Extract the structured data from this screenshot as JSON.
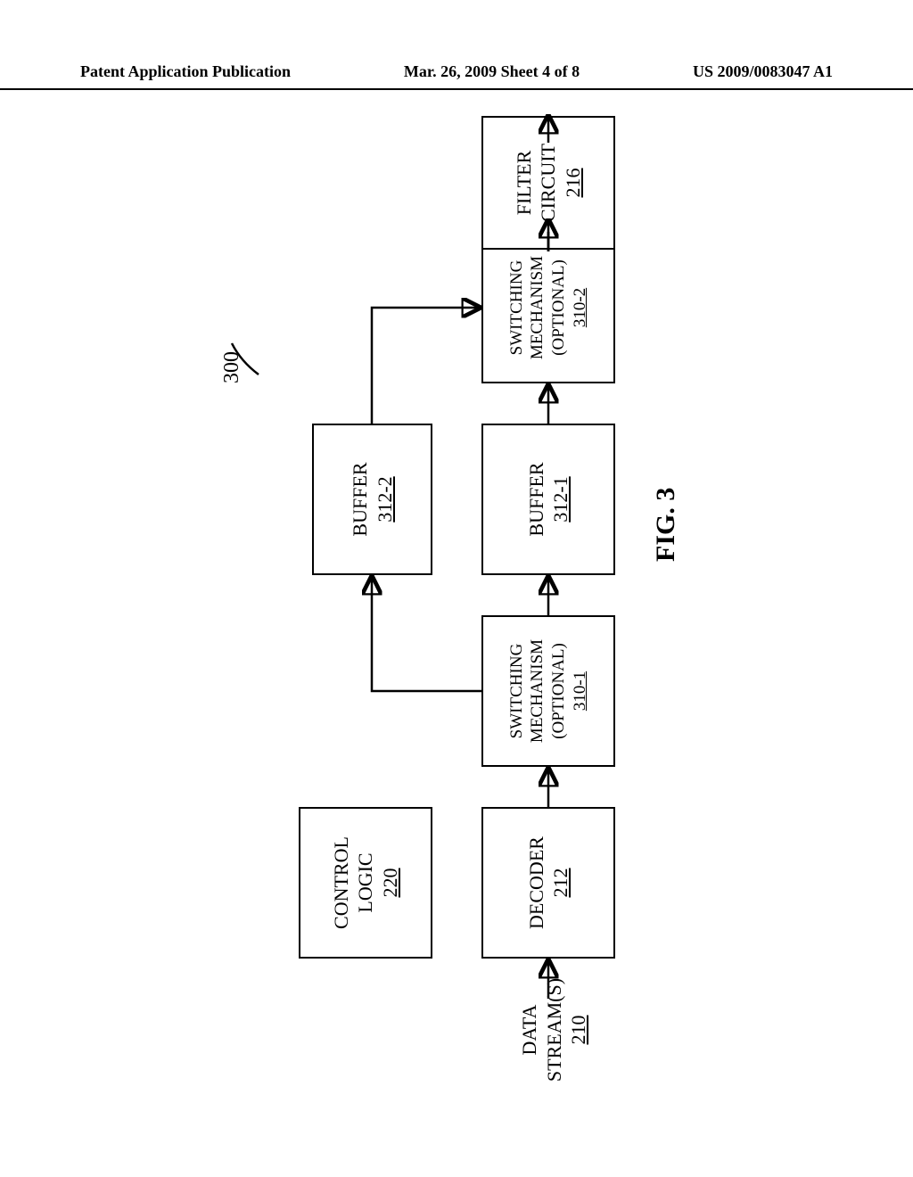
{
  "header": {
    "left": "Patent Application Publication",
    "center": "Mar. 26, 2009  Sheet 4 of 8",
    "right": "US 2009/0083047 A1"
  },
  "figure": {
    "ref_label": "300",
    "caption": "FIG. 3",
    "input": {
      "l1": "DATA",
      "l2": "STREAM(S)",
      "ref": "210"
    },
    "decoder": {
      "l1": "DECODER",
      "ref": "212"
    },
    "control": {
      "l1": "CONTROL",
      "l2": "LOGIC",
      "ref": "220"
    },
    "switch1": {
      "l1": "SWITCHING",
      "l2": "MECHANISM",
      "l3": "(OPTIONAL)",
      "ref": "310-1"
    },
    "buffer1": {
      "l1": "BUFFER",
      "ref": "312-1"
    },
    "buffer2": {
      "l1": "BUFFER",
      "ref": "312-2"
    },
    "switch2": {
      "l1": "SWITCHING",
      "l2": "MECHANISM",
      "l3": "(OPTIONAL)",
      "ref": "310-2"
    },
    "filter": {
      "l1": "FILTER",
      "l2": "CIRCUIT",
      "ref": "216"
    }
  }
}
